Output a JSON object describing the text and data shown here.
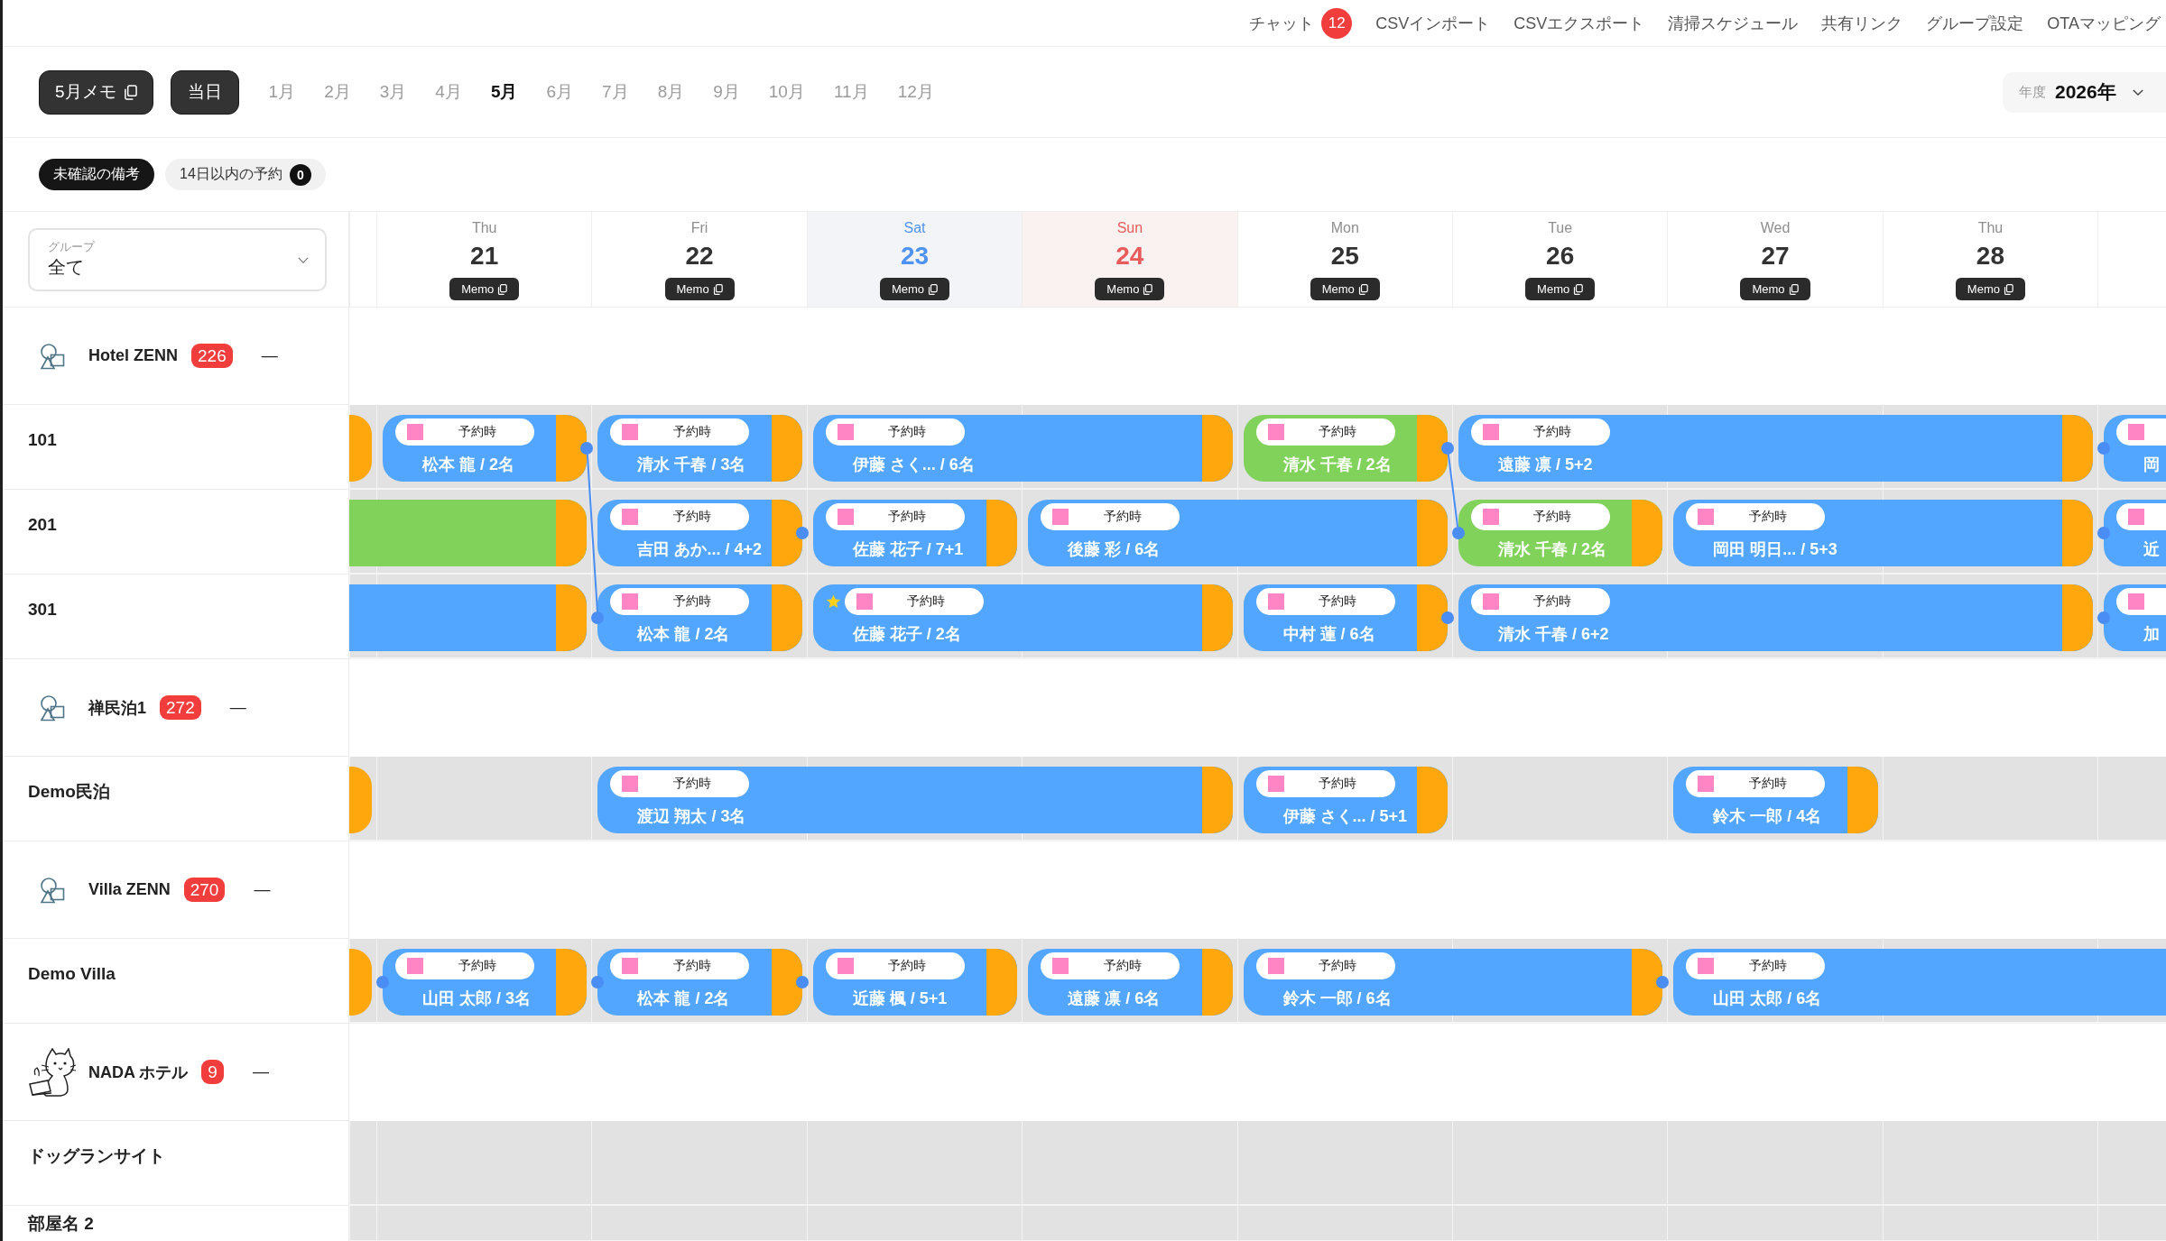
{
  "nav": [
    {
      "label": "チャット",
      "badge": "12"
    },
    {
      "label": "CSVインポート"
    },
    {
      "label": "CSVエクスポート"
    },
    {
      "label": "清掃スケジュール"
    },
    {
      "label": "共有リンク"
    },
    {
      "label": "グループ設定"
    },
    {
      "label": "OTAマッピング"
    }
  ],
  "toolbar": {
    "memo_button": "5月メモ",
    "today_button": "当日",
    "months": [
      {
        "label": "1月",
        "selected": false
      },
      {
        "label": "2月",
        "selected": false
      },
      {
        "label": "3月",
        "selected": false
      },
      {
        "label": "4月",
        "selected": false
      },
      {
        "label": "5月",
        "selected": true
      },
      {
        "label": "6月",
        "selected": false
      },
      {
        "label": "7月",
        "selected": false
      },
      {
        "label": "8月",
        "selected": false
      },
      {
        "label": "9月",
        "selected": false
      },
      {
        "label": "10月",
        "selected": false
      },
      {
        "label": "11月",
        "selected": false
      },
      {
        "label": "12月",
        "selected": false
      }
    ],
    "year": {
      "label": "年度",
      "value": "2026年"
    }
  },
  "filters": [
    {
      "label": "未確認の備考",
      "selected": true
    },
    {
      "label": "14日以内の予約",
      "selected": false,
      "badge": "0"
    }
  ],
  "calendar": {
    "group_filter": {
      "label": "グループ",
      "value": "全て"
    },
    "days": [
      {
        "weekday": "Thu",
        "date": "21",
        "kind": "weekday",
        "memo": "Memo"
      },
      {
        "weekday": "Fri",
        "date": "22",
        "kind": "weekday",
        "memo": "Memo"
      },
      {
        "weekday": "Sat",
        "date": "23",
        "kind": "saturday",
        "memo": "Memo"
      },
      {
        "weekday": "Sun",
        "date": "24",
        "kind": "sunday",
        "memo": "Memo"
      },
      {
        "weekday": "Mon",
        "date": "25",
        "kind": "weekday",
        "memo": "Memo"
      },
      {
        "weekday": "Tue",
        "date": "26",
        "kind": "weekday",
        "memo": "Memo"
      },
      {
        "weekday": "Wed",
        "date": "27",
        "kind": "weekday",
        "memo": "Memo"
      },
      {
        "weekday": "Thu",
        "date": "28",
        "kind": "weekday",
        "memo": "Memo"
      }
    ]
  },
  "groups": [
    {
      "name": "Hotel ZENN",
      "kind": "shapes",
      "count": "226",
      "collapse": "—",
      "rooms": [
        {
          "name": "101",
          "cells": [
            {
              "kind": "booking",
              "open_start": true,
              "open_end": false,
              "start_dot": false,
              "end_dot": false
            },
            {
              "kind": "booking",
              "color": "#52a6ff",
              "tag": "予約時",
              "label": "松本 龍 / 2名",
              "star": false,
              "open_start": false,
              "open_end": false,
              "start_dot": false,
              "end_dot": true,
              "end_linked": true
            },
            {
              "kind": "booking",
              "color": "#52a6ff",
              "tag": "予約時",
              "label": "清水 千春 / 3名",
              "star": false,
              "open_start": false,
              "open_end": false,
              "start_dot": false,
              "end_dot": false
            },
            {
              "kind": "booking",
              "color": "#52a6ff",
              "tag": "予約時",
              "label": "伊藤 さく... / 6名",
              "star": false,
              "open_start": false,
              "open_end": false,
              "start_dot": false,
              "end_dot": false
            },
            {
              "kind": "continued"
            },
            {
              "kind": "booking",
              "color": "#80d25b",
              "tag": "予約時",
              "label": "清水 千春 / 2名",
              "star": false,
              "open_start": false,
              "open_end": false,
              "start_dot": false,
              "end_dot": true,
              "end_linked": true
            },
            {
              "kind": "booking",
              "color": "#52a6ff",
              "tag": "予約時",
              "label": "遠藤 凛 / 5+2",
              "star": false,
              "open_start": false,
              "open_end": false,
              "start_dot": false,
              "end_dot": false
            },
            {
              "kind": "continued"
            },
            {
              "kind": "continued"
            },
            {
              "kind": "booking",
              "color": "#52a6ff",
              "label": "岡",
              "star": false,
              "open_start": false,
              "open_end": true,
              "start_dot": true,
              "end_dot": false
            }
          ]
        },
        {
          "name": "201",
          "cells": [
            {
              "kind": "booking",
              "color": "#80d25b",
              "open_start": true,
              "open_end": false,
              "start_dot": false,
              "end_dot": false
            },
            {
              "kind": "continued"
            },
            {
              "kind": "booking",
              "color": "#52a6ff",
              "tag": "予約時",
              "label": "吉田 あか... / 4+2",
              "star": false,
              "open_start": false,
              "open_end": false,
              "start_dot": false,
              "end_dot": true
            },
            {
              "kind": "booking",
              "color": "#52a6ff",
              "tag": "予約時",
              "label": "佐藤 花子 / 7+1",
              "star": false,
              "open_start": false,
              "open_end": false,
              "start_dot": false,
              "end_dot": false
            },
            {
              "kind": "booking",
              "color": "#52a6ff",
              "tag": "予約時",
              "label": "後藤 彩 / 6名",
              "star": false,
              "open_start": false,
              "open_end": false,
              "start_dot": false,
              "end_dot": false
            },
            {
              "kind": "continued"
            },
            {
              "kind": "booking",
              "color": "#80d25b",
              "tag": "予約時",
              "label": "清水 千春 / 2名",
              "star": false,
              "open_start": false,
              "open_end": false,
              "start_dot": true,
              "end_dot": false
            },
            {
              "kind": "booking",
              "color": "#52a6ff",
              "tag": "予約時",
              "label": "岡田 明日... / 5+3",
              "star": false,
              "open_start": false,
              "open_end": false,
              "start_dot": false,
              "end_dot": false
            },
            {
              "kind": "continued"
            },
            {
              "kind": "booking",
              "color": "#52a6ff",
              "label": "近",
              "star": false,
              "open_start": false,
              "open_end": true,
              "start_dot": true,
              "end_dot": false
            }
          ]
        },
        {
          "name": "301",
          "cells": [
            {
              "kind": "booking",
              "color": "#52a6ff",
              "open_start": true,
              "open_end": false,
              "start_dot": false,
              "end_dot": false
            },
            {
              "kind": "continued"
            },
            {
              "kind": "booking",
              "color": "#52a6ff",
              "tag": "予約時",
              "label": "松本 龍 / 2名",
              "star": false,
              "open_start": false,
              "open_end": false,
              "start_dot": true,
              "end_dot": false
            },
            {
              "kind": "booking",
              "color": "#52a6ff",
              "tag": "予約時",
              "label": "佐藤 花子 / 2名",
              "star": true,
              "open_start": false,
              "open_end": false,
              "start_dot": false,
              "end_dot": false
            },
            {
              "kind": "continued"
            },
            {
              "kind": "booking",
              "color": "#52a6ff",
              "tag": "予約時",
              "label": "中村 蓮 / 6名",
              "star": false,
              "open_start": false,
              "open_end": false,
              "start_dot": false,
              "end_dot": true
            },
            {
              "kind": "booking",
              "color": "#52a6ff",
              "tag": "予約時",
              "label": "清水 千春 / 6+2",
              "star": false,
              "open_start": false,
              "open_end": false,
              "start_dot": false,
              "end_dot": false
            },
            {
              "kind": "continued"
            },
            {
              "kind": "continued"
            },
            {
              "kind": "booking",
              "color": "#52a6ff",
              "label": "加",
              "star": false,
              "open_start": false,
              "open_end": true,
              "start_dot": true,
              "end_dot": false
            }
          ]
        }
      ]
    },
    {
      "name": "禅民泊1",
      "kind": "shapes",
      "count": "272",
      "collapse": "—",
      "rooms": [
        {
          "name": "Demo民泊",
          "cells": [
            {
              "kind": "booking",
              "open_start": true,
              "open_end": false,
              "start_dot": false,
              "end_dot": false
            },
            {
              "kind": "empty"
            },
            {
              "kind": "booking",
              "color": "#52a6ff",
              "tag": "予約時",
              "label": "渡辺 翔太 / 3名",
              "star": false,
              "open_start": false,
              "open_end": false,
              "start_dot": false,
              "end_dot": false
            },
            {
              "kind": "continued"
            },
            {
              "kind": "continued"
            },
            {
              "kind": "booking",
              "color": "#52a6ff",
              "tag": "予約時",
              "label": "伊藤 さく... / 5+1",
              "star": false,
              "open_start": false,
              "open_end": false,
              "start_dot": false,
              "end_dot": false
            },
            {
              "kind": "empty"
            },
            {
              "kind": "booking",
              "color": "#52a6ff",
              "tag": "予約時",
              "label": "鈴木 一郎 / 4名",
              "star": false,
              "open_start": false,
              "open_end": false,
              "start_dot": false,
              "end_dot": false
            },
            {
              "kind": "empty"
            },
            {
              "kind": "empty"
            }
          ]
        }
      ]
    },
    {
      "name": "Villa ZENN",
      "kind": "shapes",
      "count": "270",
      "collapse": "—",
      "rooms": [
        {
          "name": "Demo Villa",
          "cells": [
            {
              "kind": "booking",
              "open_start": true,
              "open_end": false,
              "start_dot": false,
              "end_dot": false
            },
            {
              "kind": "booking",
              "color": "#52a6ff",
              "tag": "予約時",
              "label": "山田 太郎 / 3名",
              "star": false,
              "open_start": false,
              "open_end": false,
              "start_dot": true,
              "end_dot": false
            },
            {
              "kind": "booking",
              "color": "#52a6ff",
              "tag": "予約時",
              "label": "松本 龍 / 2名",
              "star": false,
              "open_start": false,
              "open_end": false,
              "start_dot": true,
              "end_dot": true
            },
            {
              "kind": "booking",
              "color": "#52a6ff",
              "tag": "予約時",
              "label": "近藤 楓 / 5+1",
              "star": false,
              "open_start": false,
              "open_end": false,
              "start_dot": false,
              "end_dot": false
            },
            {
              "kind": "booking",
              "color": "#52a6ff",
              "tag": "予約時",
              "label": "遠藤 凛 / 6名",
              "star": false,
              "open_start": false,
              "open_end": false,
              "start_dot": false,
              "end_dot": false
            },
            {
              "kind": "booking",
              "color": "#52a6ff",
              "tag": "予約時",
              "label": "鈴木 一郎 / 6名",
              "star": false,
              "open_start": false,
              "open_end": false,
              "start_dot": false,
              "end_dot": true
            },
            {
              "kind": "continued"
            },
            {
              "kind": "booking",
              "color": "#52a6ff",
              "tag": "予約時",
              "label": "山田 太郎 / 6名",
              "star": false,
              "open_start": false,
              "open_end": true,
              "start_dot": false,
              "end_dot": false
            },
            {
              "kind": "continued"
            },
            {
              "kind": "continued"
            }
          ]
        }
      ]
    },
    {
      "name": "NADA ホテル",
      "kind": "cat",
      "count": "9",
      "collapse": "—",
      "rooms": [
        {
          "name": "ドッグランサイト",
          "cells": [
            {
              "kind": "empty"
            },
            {
              "kind": "empty"
            },
            {
              "kind": "empty"
            },
            {
              "kind": "empty"
            },
            {
              "kind": "empty"
            },
            {
              "kind": "empty"
            },
            {
              "kind": "empty"
            },
            {
              "kind": "empty"
            },
            {
              "kind": "empty"
            },
            {
              "kind": "empty"
            }
          ]
        },
        {
          "name": "部屋名 2",
          "cells": [
            {
              "kind": "empty"
            },
            {
              "kind": "empty"
            },
            {
              "kind": "empty"
            },
            {
              "kind": "empty"
            },
            {
              "kind": "empty"
            },
            {
              "kind": "empty"
            },
            {
              "kind": "empty"
            },
            {
              "kind": "empty"
            },
            {
              "kind": "empty"
            },
            {
              "kind": "empty"
            }
          ]
        }
      ]
    }
  ]
}
